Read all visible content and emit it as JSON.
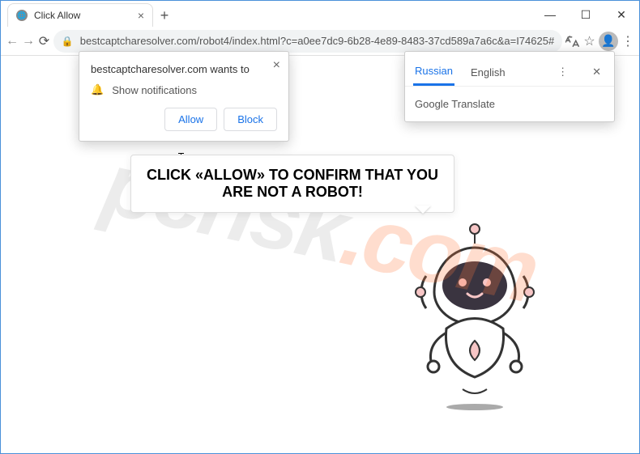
{
  "window": {
    "tab_title": "Click Allow",
    "url": "bestcaptcharesolver.com/robot4/index.html?c=a0ee7dc9-6b28-4e89-8483-37cd589a7a6c&a=I74625#"
  },
  "notification": {
    "origin": "bestcaptcharesolver.com wants to",
    "permission": "Show notifications",
    "allow": "Allow",
    "block": "Block"
  },
  "translate": {
    "tab_active": "Russian",
    "tab_other": "English",
    "brand_prefix": "Google",
    "brand_suffix": " Translate"
  },
  "page": {
    "headline": "CLICK «ALLOW» TO CONFIRM THAT YOU ARE NOT A ROBOT!"
  },
  "watermark": {
    "brand": "pcrisk",
    "tld": ".com"
  }
}
